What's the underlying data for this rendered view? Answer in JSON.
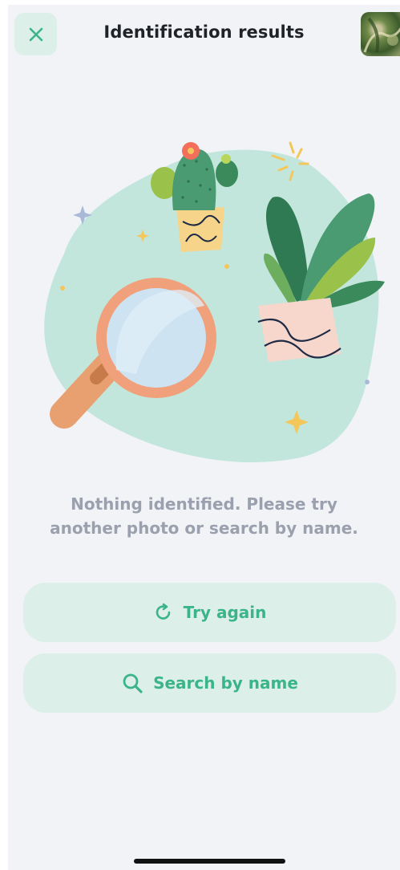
{
  "header": {
    "title": "Identification results",
    "close_icon": "close-icon",
    "thumbnail": "plant-photo-thumbnail"
  },
  "illustration": {
    "name": "magnifier-and-plants-illustration"
  },
  "message": {
    "line1": "Nothing identified. Please try",
    "line2": "another photo or search by name."
  },
  "actions": {
    "try_again_label": "Try again",
    "try_again_icon": "refresh-icon",
    "search_label": "Search by name",
    "search_icon": "search-icon"
  },
  "colors": {
    "background": "#f2f3f7",
    "accent": "#3bb48a",
    "button_bg": "#dcefe9",
    "text_muted": "#9aa0ad"
  }
}
